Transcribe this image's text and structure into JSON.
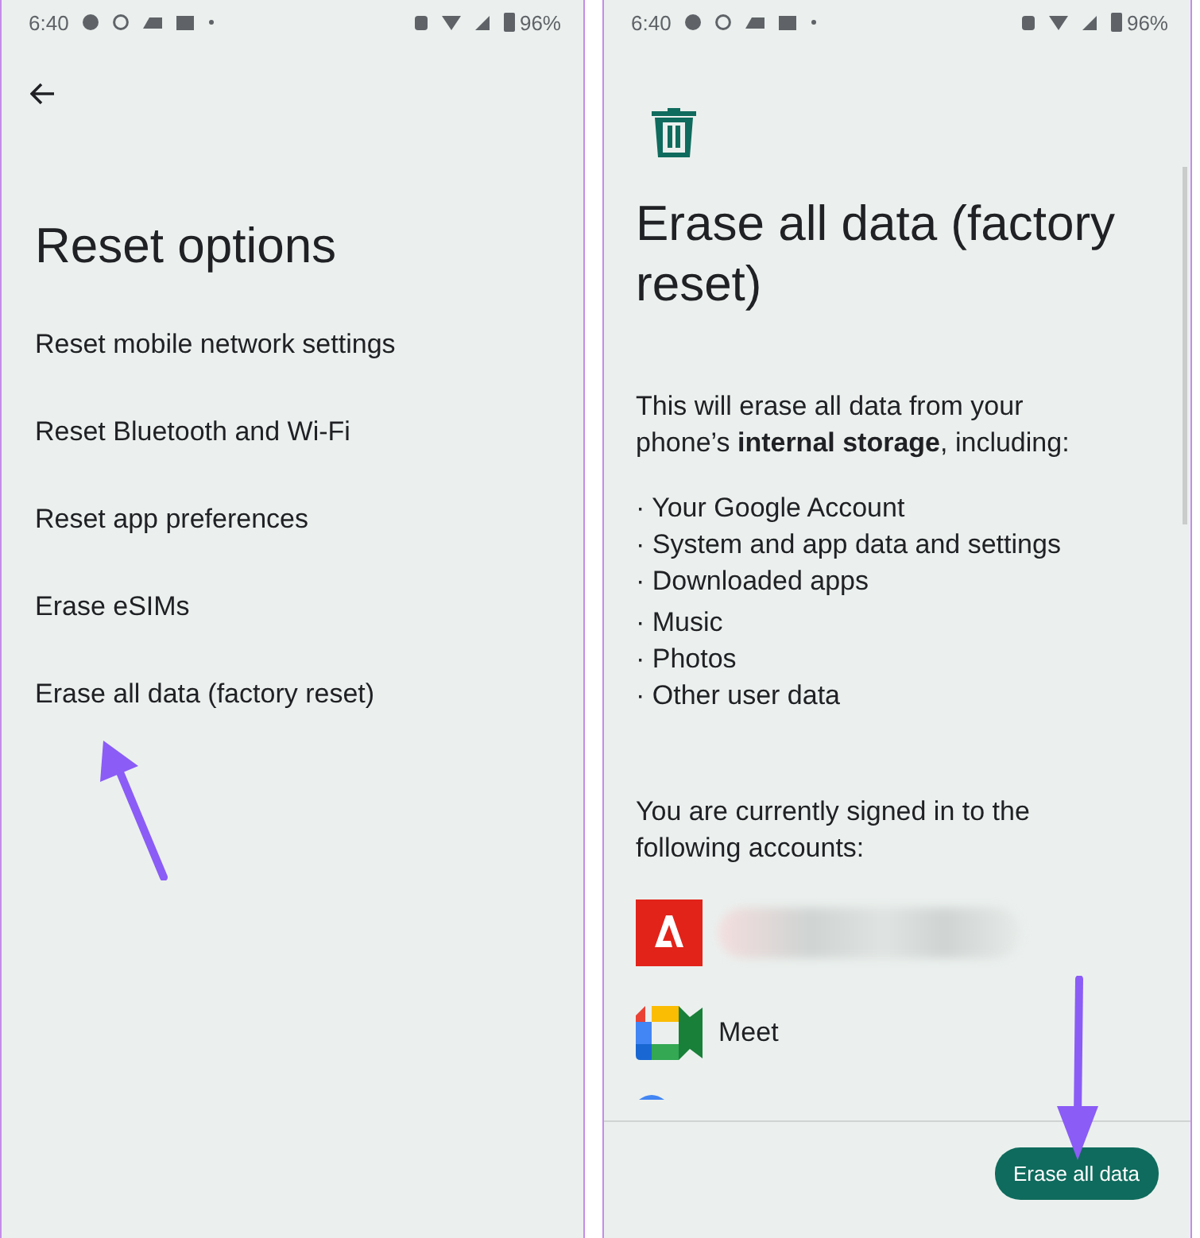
{
  "panels": [
    {
      "status_bar": {
        "time": "6:40",
        "battery": "96%"
      },
      "title": "Reset options",
      "options": [
        "Reset mobile network settings",
        "Reset Bluetooth and Wi-Fi",
        "Reset app preferences",
        "Erase eSIMs",
        "Erase all data (factory reset)"
      ]
    },
    {
      "status_bar": {
        "time": "6:40",
        "battery": "96%"
      },
      "title": "Erase all data (factory reset)",
      "intro": "This will erase all data from your phone’s **internal storage**, including:",
      "bullets": [
        [
          "· Your Google Account",
          "· System and app data and settings",
          "· Downloaded apps"
        ],
        [
          "· Music",
          "· Photos",
          "· Other user data"
        ]
      ],
      "accounts_intro": "You are currently signed in to the following accounts:",
      "accounts": [
        {
          "kind": "adobe"
        },
        {
          "kind": "meet",
          "label": "Meet"
        },
        {
          "kind": "partial"
        }
      ],
      "button": "Erase all data"
    }
  ]
}
